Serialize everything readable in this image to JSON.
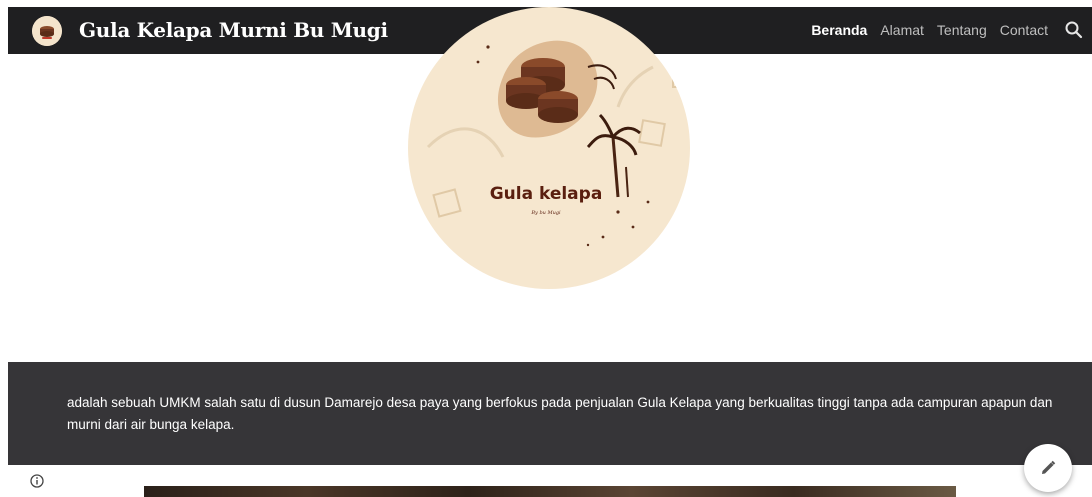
{
  "header": {
    "site_title": "Gula Kelapa Murni Bu Mugi",
    "nav": [
      {
        "label": "Beranda",
        "active": true
      },
      {
        "label": "Alamat",
        "active": false
      },
      {
        "label": "Tentang",
        "active": false
      },
      {
        "label": "Contact",
        "active": false
      }
    ],
    "search_icon": "search-icon"
  },
  "hero": {
    "logo_text": "Gula kelapa",
    "logo_subtext": "By bu Mugi"
  },
  "description": {
    "text": "adalah sebuah UMKM salah satu di dusun Damarejo desa paya yang berfokus pada penjualan Gula Kelapa yang berkualitas tinggi tanpa ada campuran apapun dan murni dari air bunga kelapa."
  },
  "icons": {
    "info": "info-icon",
    "edit": "pencil-icon"
  },
  "colors": {
    "topbar": "#1f1f21",
    "band": "#363538",
    "hero_bg": "#f6e7cf",
    "brand_brown": "#6b3520"
  }
}
